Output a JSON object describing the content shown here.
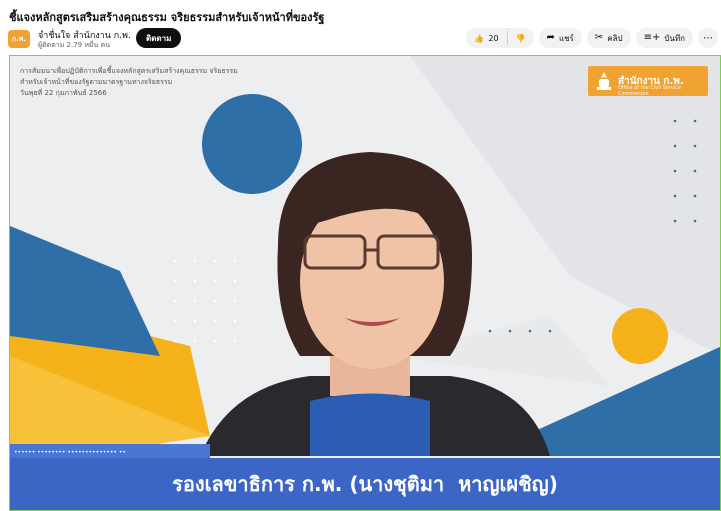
{
  "video": {
    "title": "ชี้แจงหลักสูตรเสริมสร้างคุณธรรม จริยธรรมสำหรับเจ้าหน้าที่ของรัฐ"
  },
  "channel": {
    "avatar_text": "ก.พ.",
    "name": "จำชื่นใจ สำนักงาน ก.พ.",
    "subscribers": "ผู้ติดตาม 2.79 หมื่น คน",
    "subscribe_label": "ติดตาม"
  },
  "actions": {
    "like_icon": "thumbs-up-icon",
    "like_count": "20",
    "dislike_icon": "thumbs-down-icon",
    "share_icon": "share-icon",
    "share_label": "แชร์",
    "clip_icon": "scissors-icon",
    "clip_label": "คลิป",
    "save_icon": "playlist-add-icon",
    "save_label": "บันทึก",
    "more_icon": "more-icon"
  },
  "player": {
    "header_line1": "การสัมมนาเพื่อปฏิบัติการเพื่อชี้แจงหลักสูตรเสริมสร้างคุณธรรม จริยธรรม",
    "header_line2": "สำหรับเจ้าหน้าที่ของรัฐตามมาตรฐานทางจริยธรรม",
    "header_line3": "วันพุธที่ 22 กุมภาพันธ์ 2566",
    "logo_text": "สำนักงาน ก.พ.",
    "logo_subtext": "Office of the Civil Service Commission",
    "lower_strip_text": "•••••• •••••••• •••••••••••••• ••",
    "caption": "รองเลขาธิการ ก.พ. (นางชุติมา  หาญเผชิญ)",
    "colors": {
      "caption_bg": "#3b66c5",
      "accent_orange": "#f0a232",
      "accent_blue": "#2f6fa7",
      "frame_border": "#7fd04a"
    }
  }
}
